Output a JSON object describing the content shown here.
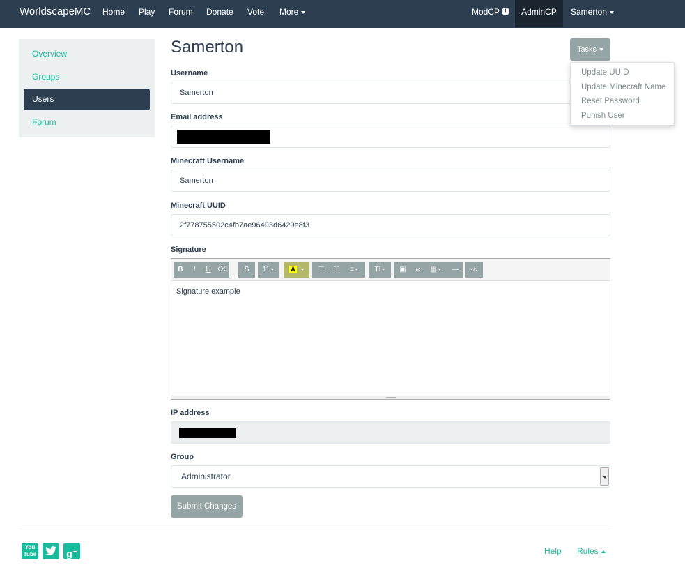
{
  "nav": {
    "brand": "WorldscapeMC",
    "links": [
      "Home",
      "Play",
      "Forum",
      "Donate",
      "Vote",
      "More"
    ],
    "modcp": "ModCP",
    "admincp": "AdminCP",
    "user": "Samerton"
  },
  "sidebar": {
    "items": [
      {
        "label": "Overview",
        "active": false
      },
      {
        "label": "Groups",
        "active": false
      },
      {
        "label": "Users",
        "active": true
      },
      {
        "label": "Forum",
        "active": false
      }
    ]
  },
  "page": {
    "title": "Samerton",
    "tasks_label": "Tasks",
    "tasks_menu": [
      "Update UUID",
      "Update Minecraft Name",
      "Reset Password",
      "Punish User"
    ]
  },
  "form": {
    "username_label": "Username",
    "username_value": "Samerton",
    "email_label": "Email address",
    "email_value": "",
    "mc_username_label": "Minecraft Username",
    "mc_username_value": "Samerton",
    "uuid_label": "Minecraft UUID",
    "uuid_value": "2f778755502c4fb7ae96493d6429e8f3",
    "signature_label": "Signature",
    "signature_text": "Signature example",
    "ip_label": "IP address",
    "ip_value": "",
    "group_label": "Group",
    "group_value": "Administrator",
    "submit_label": "Submit Changes"
  },
  "editor_toolbar": {
    "font_size": "11",
    "highlight_letter": "A",
    "color_highlight": "#ffff00"
  },
  "footer": {
    "help": "Help",
    "rules": "Rules"
  },
  "colors": {
    "navbar": "#2c3e50",
    "accent": "#18bc9c",
    "button": "#95a5a6"
  }
}
